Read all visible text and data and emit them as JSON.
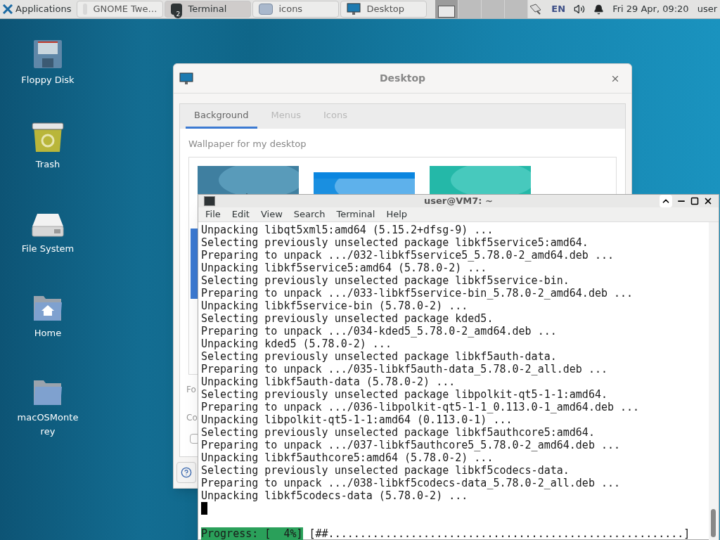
{
  "top_panel": {
    "applications": "Applications",
    "tasks": [
      {
        "label": "GNOME Twe…",
        "selected": false,
        "kind": "tweaks"
      },
      {
        "label": "Terminal",
        "selected": true,
        "kind": "terminal",
        "badge": "2"
      },
      {
        "label": "icons",
        "selected": false,
        "kind": "folder"
      },
      {
        "label": "Desktop",
        "selected": false,
        "kind": "desktop"
      }
    ],
    "workspaces": [
      {
        "selected": true
      },
      {
        "selected": false
      },
      {
        "selected": false
      },
      {
        "selected": false
      }
    ],
    "keyboard_layout": "EN",
    "clock": "Fri 29 Apr, 09:20",
    "user": "user"
  },
  "desktop_icons": [
    {
      "label": "Floppy Disk",
      "kind": "floppy"
    },
    {
      "label": "Trash",
      "kind": "trash"
    },
    {
      "label": "File System",
      "kind": "drive"
    },
    {
      "label": "Home",
      "kind": "home"
    },
    {
      "label": "macOSMonte rey",
      "kind": "folder"
    }
  ],
  "dialog": {
    "title": "Desktop",
    "tabs": [
      {
        "label": "Background",
        "selected": true
      },
      {
        "label": "Menus",
        "selected": false
      },
      {
        "label": "Icons",
        "selected": false
      }
    ],
    "section_label": "Wallpaper for my desktop",
    "cut_labels": [
      "Fo",
      "Co"
    ],
    "checkbox": {
      "checked": false
    }
  },
  "terminal": {
    "title": "user@VM7: ~",
    "menu": [
      "File",
      "Edit",
      "View",
      "Search",
      "Terminal",
      "Help"
    ],
    "lines": [
      "Unpacking libqt5xml5:amd64 (5.15.2+dfsg-9) ...",
      "Selecting previously unselected package libkf5service5:amd64.",
      "Preparing to unpack .../032-libkf5service5_5.78.0-2_amd64.deb ...",
      "Unpacking libkf5service5:amd64 (5.78.0-2) ...",
      "Selecting previously unselected package libkf5service-bin.",
      "Preparing to unpack .../033-libkf5service-bin_5.78.0-2_amd64.deb ...",
      "Unpacking libkf5service-bin (5.78.0-2) ...",
      "Selecting previously unselected package kded5.",
      "Preparing to unpack .../034-kded5_5.78.0-2_amd64.deb ...",
      "Unpacking kded5 (5.78.0-2) ...",
      "Selecting previously unselected package libkf5auth-data.",
      "Preparing to unpack .../035-libkf5auth-data_5.78.0-2_all.deb ...",
      "Unpacking libkf5auth-data (5.78.0-2) ...",
      "Selecting previously unselected package libpolkit-qt5-1-1:amd64.",
      "Preparing to unpack .../036-libpolkit-qt5-1-1_0.113.0-1_amd64.deb ...",
      "Unpacking libpolkit-qt5-1-1:amd64 (0.113.0-1) ...",
      "Selecting previously unselected package libkf5authcore5:amd64.",
      "Preparing to unpack .../037-libkf5authcore5_5.78.0-2_amd64.deb ...",
      "Unpacking libkf5authcore5:amd64 (5.78.0-2) ...",
      "Selecting previously unselected package libkf5codecs-data.",
      "Preparing to unpack .../038-libkf5codecs-data_5.78.0-2_all.deb ...",
      "Unpacking libkf5codecs-data (5.78.0-2) ..."
    ],
    "progress_label": "Progress: [  4%]",
    "progress_bar": "[##........................................................]"
  }
}
